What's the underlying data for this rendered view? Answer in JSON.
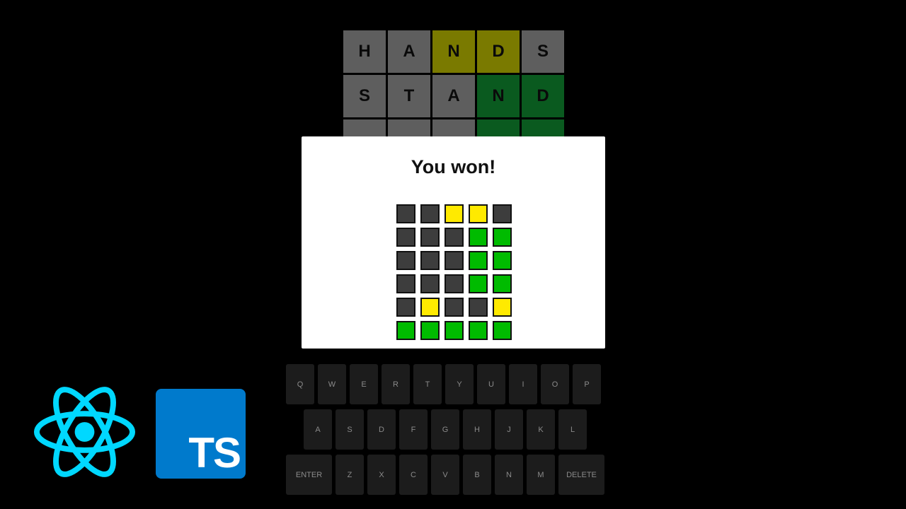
{
  "board": {
    "rows": [
      {
        "letters": [
          "H",
          "A",
          "N",
          "D",
          "S"
        ],
        "states": [
          "absent",
          "absent",
          "present",
          "present",
          "absent"
        ]
      },
      {
        "letters": [
          "S",
          "T",
          "A",
          "N",
          "D"
        ],
        "states": [
          "absent",
          "absent",
          "absent",
          "correct",
          "correct"
        ]
      },
      {
        "letters": [
          "",
          "",
          "",
          "",
          ""
        ],
        "states": [
          "absent",
          "absent",
          "absent",
          "correct",
          "correct"
        ]
      }
    ]
  },
  "modal": {
    "title": "You won!",
    "grid": [
      [
        "g",
        "g",
        "y",
        "y",
        "g"
      ],
      [
        "g",
        "g",
        "g",
        "gr",
        "gr"
      ],
      [
        "g",
        "g",
        "g",
        "gr",
        "gr"
      ],
      [
        "g",
        "g",
        "g",
        "gr",
        "gr"
      ],
      [
        "g",
        "y",
        "g",
        "g",
        "y"
      ],
      [
        "gr",
        "gr",
        "gr",
        "gr",
        "gr"
      ]
    ]
  },
  "keyboard": {
    "row1": [
      "Q",
      "W",
      "E",
      "R",
      "T",
      "Y",
      "U",
      "I",
      "O",
      "P"
    ],
    "row2": [
      "A",
      "S",
      "D",
      "F",
      "G",
      "H",
      "J",
      "K",
      "L"
    ],
    "row3": [
      "ENTER",
      "Z",
      "X",
      "C",
      "V",
      "B",
      "N",
      "M",
      "DELETE"
    ]
  },
  "logos": {
    "react": "react-logo",
    "ts": "TS"
  },
  "colors": {
    "absent": "#5e5e5e",
    "present": "#7a7a00",
    "correct": "#0a5a1f",
    "modal_gray": "#3d3d3d",
    "modal_yellow": "#ffea00",
    "modal_green": "#00bb00",
    "react_blue": "#00d8ff",
    "ts_blue": "#007acc"
  }
}
